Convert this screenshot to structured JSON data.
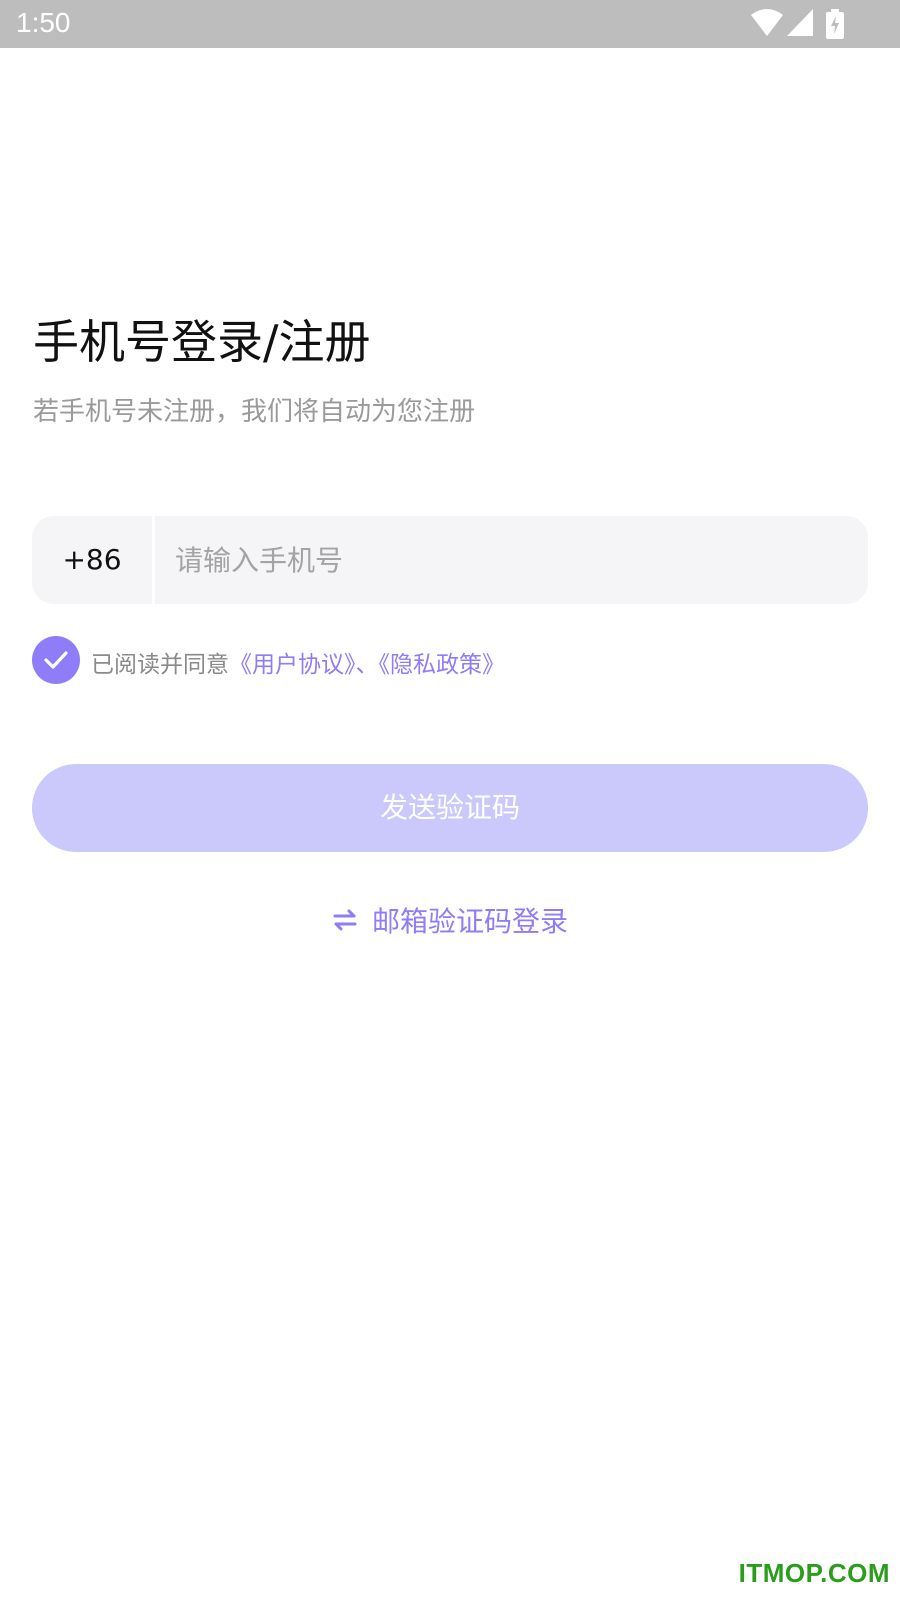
{
  "status_bar": {
    "time": "1:50",
    "icons": [
      "wifi-icon",
      "cell-signal-icon",
      "battery-charging-icon"
    ]
  },
  "page": {
    "title": "手机号登录/注册",
    "subtitle": "若手机号未注册，我们将自动为您注册"
  },
  "phone_field": {
    "country_code": "+86",
    "placeholder": "请输入手机号",
    "value": ""
  },
  "agreement": {
    "checked": true,
    "prefix": "已阅读并同意",
    "user_agreement": "《用户协议》",
    "separator": "、",
    "privacy_policy": "《隐私政策》"
  },
  "send_button": {
    "label": "发送验证码"
  },
  "email_login": {
    "icon": "swap-arrows-icon",
    "label": "邮箱验证码登录"
  },
  "watermark": "ITMOP.COM",
  "colors": {
    "accent": "#8e7cf8",
    "button_disabled": "#cbc8fb",
    "status_bar": "#bdbdbd",
    "field_bg": "#f5f5f7",
    "watermark": "#2a9e1a"
  }
}
